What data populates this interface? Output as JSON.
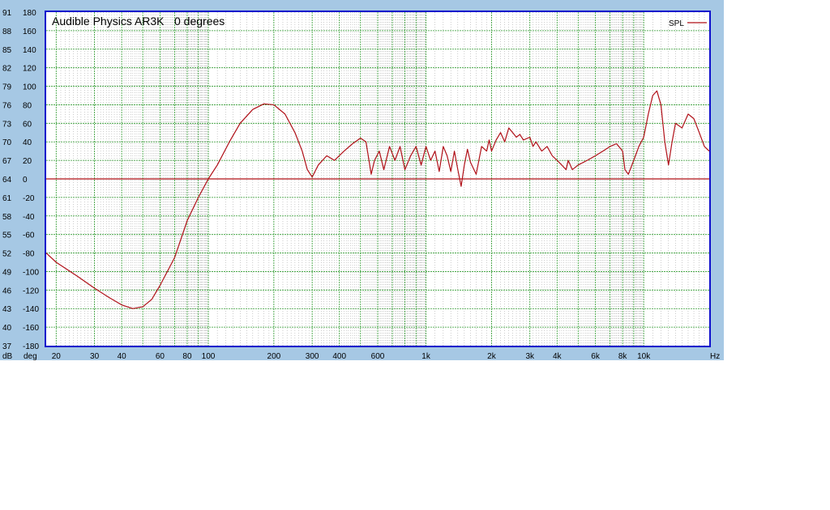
{
  "chart_data": {
    "type": "line",
    "title": "Audible Physics AR3K",
    "subtitle": "0 degrees",
    "xlabel": "Hz",
    "x_scale": "log",
    "xlim": [
      18,
      20000
    ],
    "x_ticks": [
      {
        "value": 20,
        "label": "20"
      },
      {
        "value": 30,
        "label": "30"
      },
      {
        "value": 40,
        "label": "40"
      },
      {
        "value": 60,
        "label": "60"
      },
      {
        "value": 80,
        "label": "80"
      },
      {
        "value": 100,
        "label": "100"
      },
      {
        "value": 200,
        "label": "200"
      },
      {
        "value": 300,
        "label": "300"
      },
      {
        "value": 400,
        "label": "400"
      },
      {
        "value": 600,
        "label": "600"
      },
      {
        "value": 1000,
        "label": "1k"
      },
      {
        "value": 2000,
        "label": "2k"
      },
      {
        "value": 3000,
        "label": "3k"
      },
      {
        "value": 4000,
        "label": "4k"
      },
      {
        "value": 6000,
        "label": "6k"
      },
      {
        "value": 8000,
        "label": "8k"
      },
      {
        "value": 10000,
        "label": "10k"
      }
    ],
    "y_axes": [
      {
        "label": "dB",
        "range": [
          37,
          91
        ],
        "ticks": [
          37,
          40,
          43,
          46,
          49,
          52,
          55,
          58,
          61,
          64,
          67,
          70,
          73,
          76,
          79,
          82,
          85,
          88,
          91
        ]
      },
      {
        "label": "deg",
        "range": [
          -180,
          180
        ],
        "ticks": [
          -180,
          -160,
          -140,
          -120,
          -100,
          -80,
          -60,
          -40,
          -20,
          0,
          20,
          40,
          60,
          80,
          100,
          120,
          140,
          160,
          180
        ]
      }
    ],
    "grid": true,
    "legend_position": "top-right",
    "colors": {
      "background": "#a6c8e4",
      "plot_background": "#ffffff",
      "plot_border": "#1010cc",
      "grid_major": "#2e9a2e",
      "grid_minor": "#9a9a9a",
      "series": "#b01018"
    },
    "series": [
      {
        "name": "SPL",
        "unit": "deg",
        "color": "#b01018",
        "points": [
          [
            18,
            -80
          ],
          [
            20,
            -90
          ],
          [
            25,
            -105
          ],
          [
            30,
            -118
          ],
          [
            35,
            -128
          ],
          [
            40,
            -136
          ],
          [
            45,
            -140
          ],
          [
            50,
            -138
          ],
          [
            55,
            -130
          ],
          [
            60,
            -115
          ],
          [
            70,
            -85
          ],
          [
            80,
            -45
          ],
          [
            90,
            -20
          ],
          [
            100,
            0
          ],
          [
            110,
            15
          ],
          [
            125,
            40
          ],
          [
            140,
            60
          ],
          [
            160,
            75
          ],
          [
            180,
            81
          ],
          [
            200,
            80
          ],
          [
            225,
            70
          ],
          [
            250,
            50
          ],
          [
            270,
            30
          ],
          [
            285,
            10
          ],
          [
            300,
            2
          ],
          [
            320,
            15
          ],
          [
            350,
            25
          ],
          [
            380,
            20
          ],
          [
            420,
            30
          ],
          [
            460,
            38
          ],
          [
            500,
            44
          ],
          [
            530,
            40
          ],
          [
            560,
            5
          ],
          [
            580,
            20
          ],
          [
            610,
            30
          ],
          [
            640,
            10
          ],
          [
            680,
            35
          ],
          [
            720,
            20
          ],
          [
            760,
            35
          ],
          [
            800,
            10
          ],
          [
            850,
            25
          ],
          [
            900,
            35
          ],
          [
            950,
            15
          ],
          [
            1000,
            35
          ],
          [
            1050,
            20
          ],
          [
            1100,
            30
          ],
          [
            1150,
            8
          ],
          [
            1200,
            35
          ],
          [
            1250,
            25
          ],
          [
            1300,
            8
          ],
          [
            1350,
            30
          ],
          [
            1400,
            10
          ],
          [
            1450,
            -8
          ],
          [
            1500,
            15
          ],
          [
            1550,
            32
          ],
          [
            1600,
            18
          ],
          [
            1700,
            5
          ],
          [
            1800,
            35
          ],
          [
            1900,
            30
          ],
          [
            1950,
            42
          ],
          [
            2000,
            30
          ],
          [
            2100,
            42
          ],
          [
            2200,
            50
          ],
          [
            2300,
            40
          ],
          [
            2400,
            55
          ],
          [
            2500,
            50
          ],
          [
            2600,
            45
          ],
          [
            2700,
            48
          ],
          [
            2800,
            42
          ],
          [
            3000,
            45
          ],
          [
            3100,
            35
          ],
          [
            3200,
            40
          ],
          [
            3400,
            30
          ],
          [
            3600,
            35
          ],
          [
            3800,
            25
          ],
          [
            4000,
            20
          ],
          [
            4200,
            15
          ],
          [
            4400,
            10
          ],
          [
            4500,
            20
          ],
          [
            4700,
            10
          ],
          [
            5000,
            15
          ],
          [
            5500,
            20
          ],
          [
            6000,
            25
          ],
          [
            6500,
            30
          ],
          [
            7000,
            35
          ],
          [
            7500,
            38
          ],
          [
            8000,
            30
          ],
          [
            8200,
            10
          ],
          [
            8500,
            5
          ],
          [
            9000,
            20
          ],
          [
            9500,
            35
          ],
          [
            10000,
            45
          ],
          [
            10500,
            70
          ],
          [
            11000,
            90
          ],
          [
            11500,
            95
          ],
          [
            12000,
            80
          ],
          [
            12500,
            40
          ],
          [
            13000,
            15
          ],
          [
            13500,
            40
          ],
          [
            14000,
            60
          ],
          [
            15000,
            55
          ],
          [
            16000,
            70
          ],
          [
            17000,
            65
          ],
          [
            18000,
            50
          ],
          [
            19000,
            35
          ],
          [
            20000,
            30
          ]
        ]
      },
      {
        "name": "",
        "unit": "deg",
        "color": "#b01018",
        "points": [
          [
            18,
            0
          ],
          [
            20000,
            0
          ]
        ]
      }
    ]
  }
}
